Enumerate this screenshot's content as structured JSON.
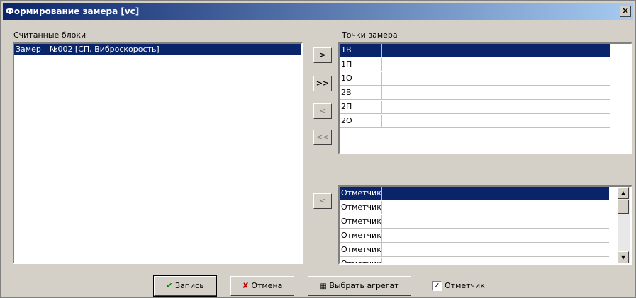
{
  "window": {
    "title": "Формирование замера [vc]",
    "close_glyph": "×"
  },
  "left_panel": {
    "label": "Считанные блоки",
    "items": [
      {
        "col1": "Замер",
        "col2": "№002 [СП, Виброскорость]"
      }
    ]
  },
  "right_panel": {
    "label": "Точки замера",
    "points": [
      "1В",
      "1П",
      "1О",
      "2В",
      "2П",
      "2О"
    ],
    "markers": [
      "Отметчик",
      "Отметчик",
      "Отметчик",
      "Отметчик",
      "Отметчик",
      "Отметчик"
    ]
  },
  "arrows": {
    "add": ">",
    "add_all": ">>",
    "remove": "<",
    "remove_all": "<<",
    "remove_marker": "<"
  },
  "footer": {
    "save": "Запись",
    "cancel": "Отмена",
    "select_unit": "Выбрать агрегат",
    "marker_checkbox_label": "Отметчик",
    "marker_checked": true
  },
  "colors": {
    "selection": "#0a246a",
    "title_start": "#0a246a",
    "title_end": "#a6caf0"
  }
}
